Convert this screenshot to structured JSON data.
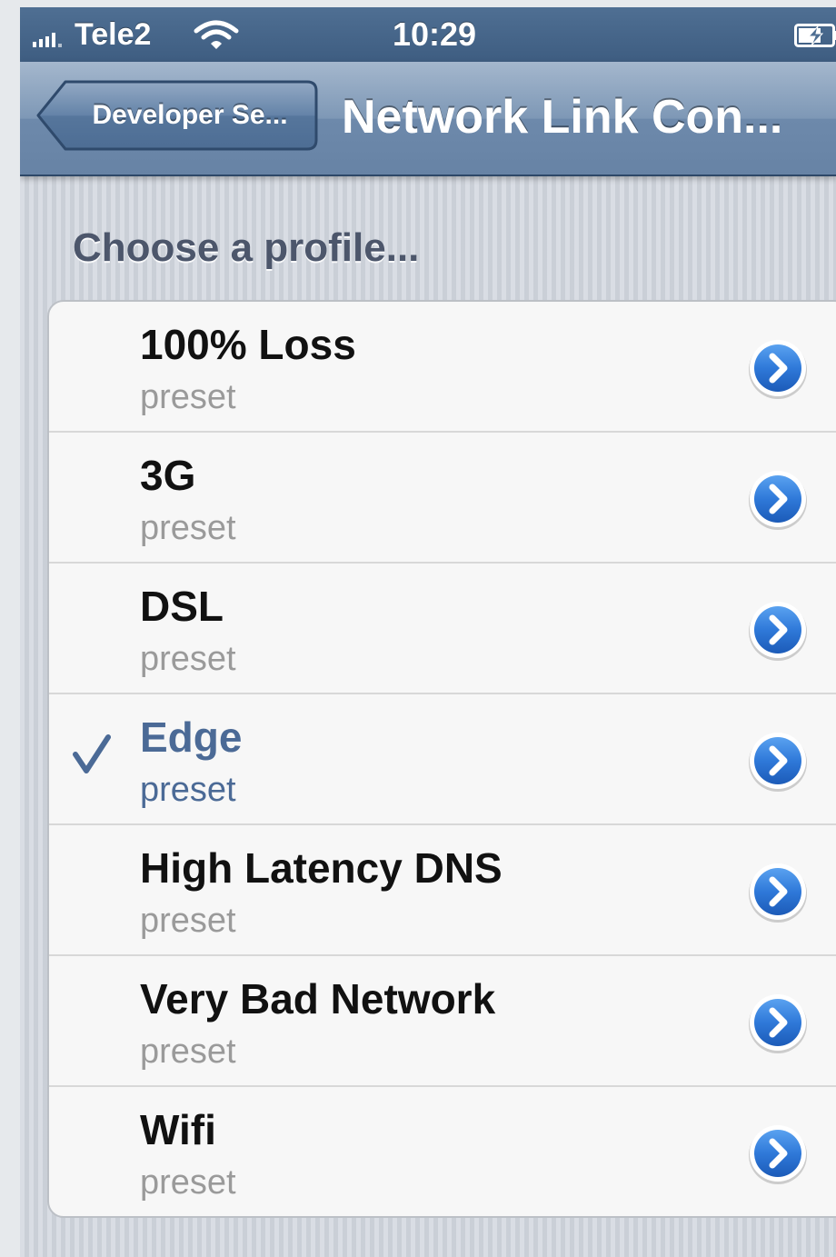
{
  "status_bar": {
    "carrier": "Tele2",
    "time": "10:29"
  },
  "nav": {
    "back_label": "Developer Se...",
    "title": "Network Link Con..."
  },
  "section_header": "Choose a profile...",
  "profiles": [
    {
      "title": "100% Loss",
      "subtitle": "preset",
      "selected": false
    },
    {
      "title": "3G",
      "subtitle": "preset",
      "selected": false
    },
    {
      "title": "DSL",
      "subtitle": "preset",
      "selected": false
    },
    {
      "title": "Edge",
      "subtitle": "preset",
      "selected": true
    },
    {
      "title": "High Latency DNS",
      "subtitle": "preset",
      "selected": false
    },
    {
      "title": "Very Bad Network",
      "subtitle": "preset",
      "selected": false
    },
    {
      "title": "Wifi",
      "subtitle": "preset",
      "selected": false
    }
  ],
  "icons": {
    "checkmark": "checkmark-icon",
    "row_accessory": "detail-disclosure-icon",
    "signal": "signal-strength-icon",
    "wifi": "wifi-icon",
    "battery": "battery-charging-icon"
  },
  "colors": {
    "nav_bar": "#6d89ab",
    "selected_text": "#4b6a96",
    "disclosure_button": "#2f79d9",
    "section_header": "#4c566b"
  }
}
